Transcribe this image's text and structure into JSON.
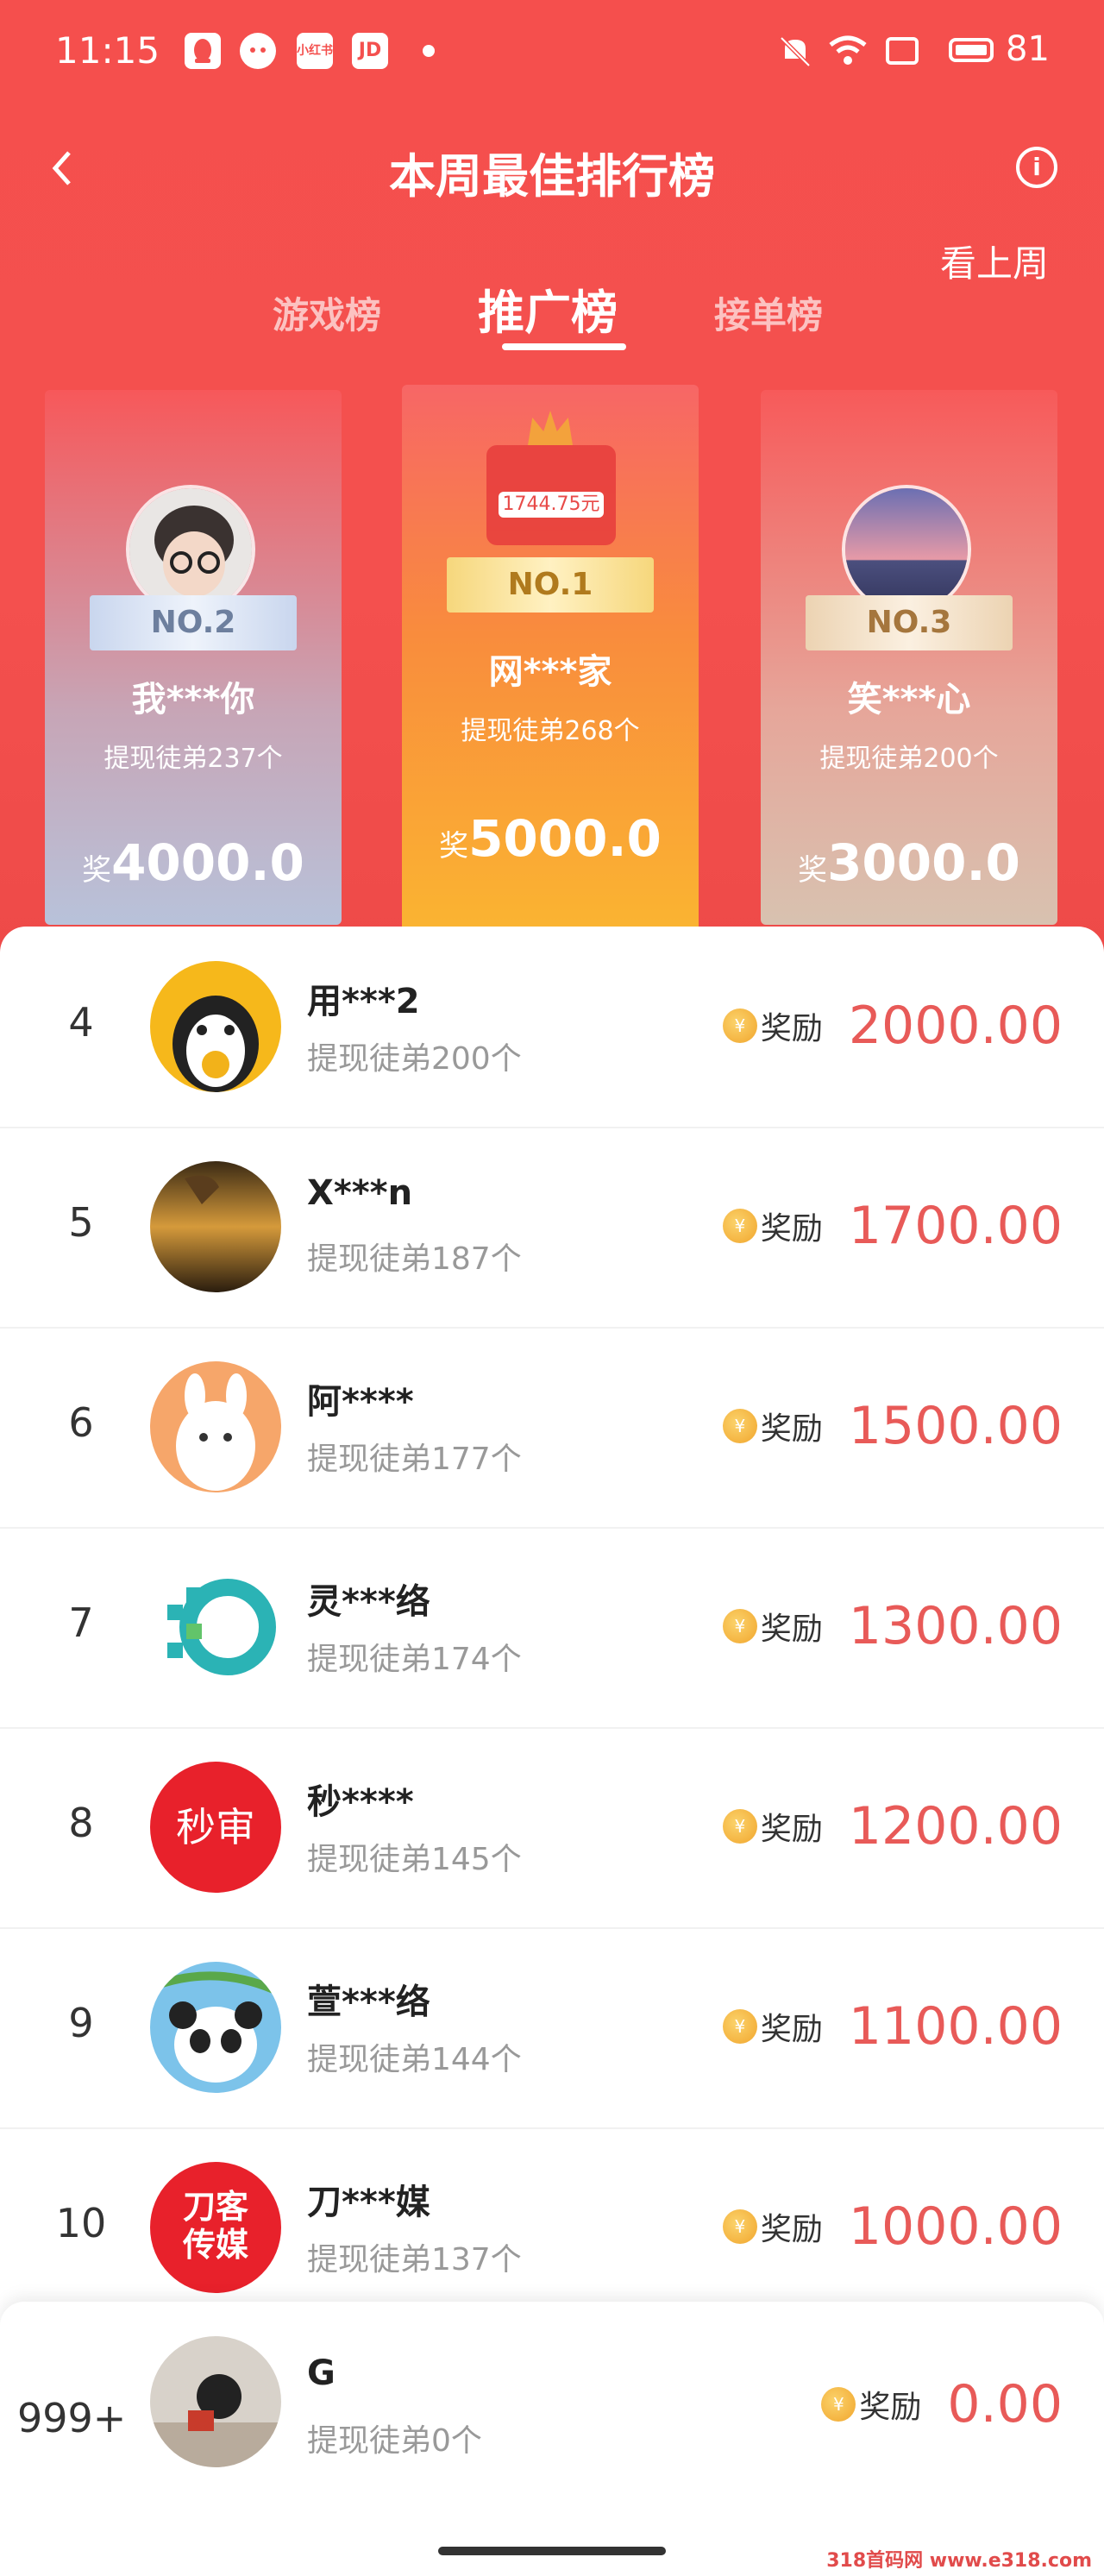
{
  "status_bar": {
    "time": "11:15",
    "battery": "81",
    "app_icons": [
      "qq-icon",
      "wechat-icon",
      "xiaohongshu-icon",
      "jd-icon"
    ],
    "xhs_text": "小红书",
    "jd_text": "JD"
  },
  "nav": {
    "title": "本周最佳排行榜",
    "last_week": "看上周",
    "info_icon": "info-icon"
  },
  "tabs": [
    {
      "label": "游戏榜",
      "active": false
    },
    {
      "label": "推广榜",
      "active": true
    },
    {
      "label": "接单榜",
      "active": false
    }
  ],
  "podium": {
    "first": {
      "badge": "NO.1",
      "name": "网***家",
      "sub": "提现徒弟268个",
      "reward_prefix": "奖",
      "reward": "5000.0",
      "poster_amount": "1744.75元"
    },
    "second": {
      "badge": "NO.2",
      "name": "我***你",
      "sub": "提现徒弟237个",
      "reward_prefix": "奖",
      "reward": "4000.0"
    },
    "third": {
      "badge": "NO.3",
      "name": "笑***心",
      "sub": "提现徒弟200个",
      "reward_prefix": "奖",
      "reward": "3000.0"
    }
  },
  "reward_label": "奖励",
  "list": [
    {
      "rank": "4",
      "name": "用***2",
      "sub": "提现徒弟200个",
      "amount": "2000.00",
      "avatar": "penguin-avatar"
    },
    {
      "rank": "5",
      "name": "X***n",
      "sub": "提现徒弟187个",
      "amount": "1700.00",
      "avatar": "sunset-hand-avatar"
    },
    {
      "rank": "6",
      "name": "阿****",
      "sub": "提现徒弟177个",
      "amount": "1500.00",
      "avatar": "bunny-avatar"
    },
    {
      "rank": "7",
      "name": "灵***络",
      "sub": "提现徒弟174个",
      "amount": "1300.00",
      "avatar": "pixel-logo-avatar"
    },
    {
      "rank": "8",
      "name": "秒****",
      "sub": "提现徒弟145个",
      "amount": "1200.00",
      "avatar": "miaoshen-avatar",
      "avatar_text": "秒审"
    },
    {
      "rank": "9",
      "name": "萱***络",
      "sub": "提现徒弟144个",
      "amount": "1100.00",
      "avatar": "panda-avatar"
    },
    {
      "rank": "10",
      "name": "刀***媒",
      "sub": "提现徒弟137个",
      "amount": "1000.00",
      "avatar": "daoke-avatar",
      "avatar_text": "刀客传媒"
    }
  ],
  "me": {
    "rank": "999+",
    "name": "G",
    "sub": "提现徒弟0个",
    "amount": "0.00"
  },
  "watermark": "318首码网 www.e318.com",
  "colors": {
    "brand_red": "#f4504e",
    "amount_red": "#e85a58",
    "coin_gold": "#f1a52c"
  }
}
